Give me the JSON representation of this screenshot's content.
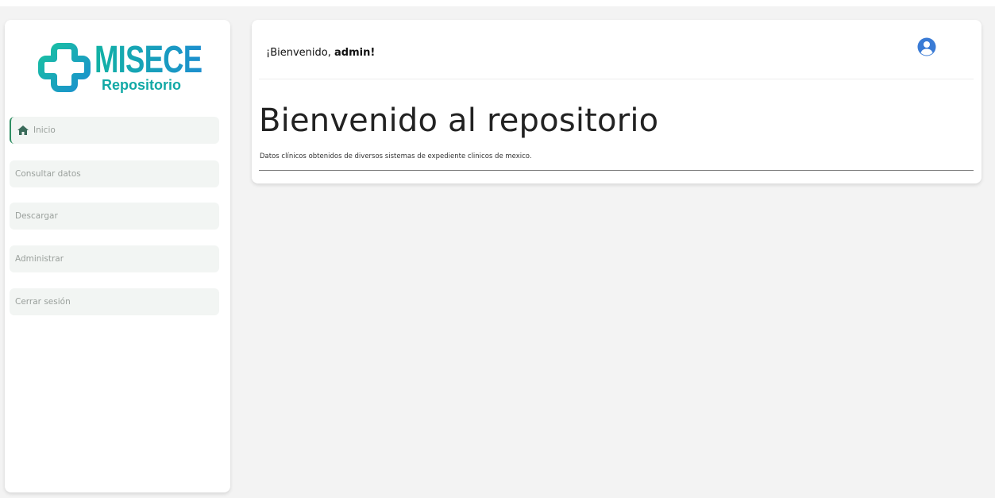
{
  "brand": {
    "name": "MISECE",
    "subtitle": "Repositorio",
    "colors": {
      "teal": "#12b2a4",
      "blue": "#1d8fcf"
    }
  },
  "sidebar": {
    "items": [
      {
        "label": "Inicio",
        "icon": "home-icon",
        "active": true
      },
      {
        "label": "Consultar datos"
      },
      {
        "label": "Descargar"
      },
      {
        "label": "Administrar"
      },
      {
        "label": "Cerrar sesión"
      }
    ]
  },
  "header": {
    "greeting_prefix": "¡Bienvenido, ",
    "username": "admin!",
    "user_icon": "user-circle-icon",
    "user_icon_color": "#3a7bd5"
  },
  "main": {
    "title": "Bienvenido al repositorio",
    "description": "Datos clínicos obtenidos de diversos sistemas de expediente clinicos de mexico."
  },
  "colors": {
    "active_accent": "#2f8f63",
    "nav_bg": "#f2f5f3",
    "page_bg": "#f3f3f3"
  }
}
